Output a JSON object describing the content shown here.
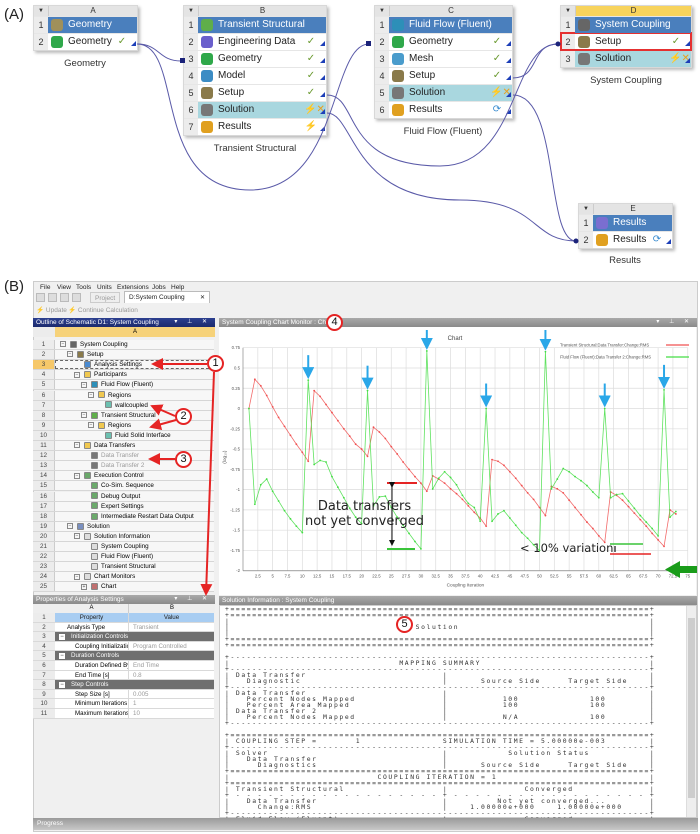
{
  "part_a": {
    "label": "(A)",
    "systems": [
      {
        "id": "geometry",
        "letter": "A",
        "caption": "Geometry",
        "rows": [
          {
            "n": "1",
            "label": "Geometry",
            "icon": "geometry-box-icon",
            "kind": "head"
          },
          {
            "n": "2",
            "label": "Geometry",
            "icon": "designmodeler-icon",
            "status": "check"
          }
        ]
      },
      {
        "id": "transient-structural",
        "letter": "B",
        "caption": "Transient Structural",
        "rows": [
          {
            "n": "1",
            "label": "Transient Structural",
            "icon": "transient-structural-icon",
            "kind": "head"
          },
          {
            "n": "2",
            "label": "Engineering Data",
            "icon": "engineering-data-icon",
            "status": "check"
          },
          {
            "n": "3",
            "label": "Geometry",
            "icon": "designmodeler-icon",
            "status": "check"
          },
          {
            "n": "4",
            "label": "Model",
            "icon": "model-icon",
            "status": "check"
          },
          {
            "n": "5",
            "label": "Setup",
            "icon": "setup-icon",
            "status": "check"
          },
          {
            "n": "6",
            "label": "Solution",
            "icon": "solution-icon",
            "status": "refresh-failed",
            "kind": "sol"
          },
          {
            "n": "7",
            "label": "Results",
            "icon": "results-icon",
            "status": "update-required"
          }
        ]
      },
      {
        "id": "fluid-flow",
        "letter": "C",
        "caption": "Fluid Flow (Fluent)",
        "rows": [
          {
            "n": "1",
            "label": "Fluid Flow (Fluent)",
            "icon": "fluent-icon",
            "kind": "head"
          },
          {
            "n": "2",
            "label": "Geometry",
            "icon": "designmodeler-icon",
            "status": "check"
          },
          {
            "n": "3",
            "label": "Mesh",
            "icon": "mesh-icon",
            "status": "check"
          },
          {
            "n": "4",
            "label": "Setup",
            "icon": "setup-icon",
            "status": "check"
          },
          {
            "n": "5",
            "label": "Solution",
            "icon": "solution-icon",
            "status": "refresh-failed",
            "kind": "sol"
          },
          {
            "n": "6",
            "label": "Results",
            "icon": "results-icon",
            "status": "refresh"
          }
        ]
      },
      {
        "id": "system-coupling",
        "letter": "D",
        "caption": "System Coupling",
        "rows": [
          {
            "n": "1",
            "label": "System Coupling",
            "icon": "system-coupling-icon",
            "kind": "head"
          },
          {
            "n": "2",
            "label": "Setup",
            "icon": "setup-icon",
            "status": "check",
            "kind": "highlight"
          },
          {
            "n": "3",
            "label": "Solution",
            "icon": "solution-icon",
            "status": "refresh-failed",
            "kind": "sol"
          }
        ]
      },
      {
        "id": "results",
        "letter": "E",
        "caption": "Results",
        "rows": [
          {
            "n": "1",
            "label": "Results",
            "icon": "results-eye-icon",
            "kind": "head"
          },
          {
            "n": "2",
            "label": "Results",
            "icon": "results-icon",
            "status": "refresh"
          }
        ]
      }
    ]
  },
  "part_b": {
    "label": "(B)",
    "menu": [
      "File",
      "View",
      "Tools",
      "Units",
      "Extensions",
      "Jobs",
      "Help"
    ],
    "tabs": {
      "project": "Project",
      "active": "D:System Coupling",
      "close": "✕"
    },
    "toolbar": {
      "update": "Update",
      "continue": "Continue Calculation"
    },
    "outline": {
      "title": "Outline of Schematic D1: System Coupling",
      "column": "A",
      "rows": [
        {
          "n": "1",
          "label": "System Coupling",
          "level": 0,
          "exp": "−",
          "icon": "system-coupling-icon"
        },
        {
          "n": "2",
          "label": "Setup",
          "level": 1,
          "exp": "−",
          "icon": "setup-icon"
        },
        {
          "n": "3",
          "label": "Analysis Settings",
          "level": 2,
          "icon": "analysis-settings-icon",
          "selected": true
        },
        {
          "n": "4",
          "label": "Participants",
          "level": 2,
          "exp": "−",
          "icon": "folder-icon"
        },
        {
          "n": "5",
          "label": "Fluid Flow (Fluent)",
          "level": 3,
          "exp": "−",
          "icon": "fluent-icon"
        },
        {
          "n": "6",
          "label": "Regions",
          "level": 4,
          "exp": "−",
          "icon": "folder-icon"
        },
        {
          "n": "7",
          "label": "wallcoupled",
          "level": 5,
          "icon": "region-icon"
        },
        {
          "n": "8",
          "label": "Transient Structural",
          "level": 3,
          "exp": "−",
          "icon": "transient-structural-icon"
        },
        {
          "n": "9",
          "label": "Regions",
          "level": 4,
          "exp": "−",
          "icon": "folder-icon"
        },
        {
          "n": "10",
          "label": "Fluid Solid Interface",
          "level": 5,
          "icon": "region-icon"
        },
        {
          "n": "11",
          "label": "Data Transfers",
          "level": 2,
          "exp": "−",
          "icon": "folder-icon"
        },
        {
          "n": "12",
          "label": "Data Transfer",
          "level": 3,
          "icon": "data-transfer-icon",
          "grey": true
        },
        {
          "n": "13",
          "label": "Data Transfer 2",
          "level": 3,
          "icon": "data-transfer-icon",
          "grey": true
        },
        {
          "n": "14",
          "label": "Execution Control",
          "level": 2,
          "exp": "−",
          "icon": "settings-sheet-icon"
        },
        {
          "n": "15",
          "label": "Co-Sim. Sequence",
          "level": 3,
          "icon": "settings-sheet-icon"
        },
        {
          "n": "16",
          "label": "Debug Output",
          "level": 3,
          "icon": "settings-sheet-icon"
        },
        {
          "n": "17",
          "label": "Expert Settings",
          "level": 3,
          "icon": "settings-sheet-icon"
        },
        {
          "n": "18",
          "label": "Intermediate Restart Data Output",
          "level": 3,
          "icon": "settings-sheet-icon"
        },
        {
          "n": "19",
          "label": "Solution",
          "level": 1,
          "exp": "−",
          "icon": "solution-icon"
        },
        {
          "n": "20",
          "label": "Solution Information",
          "level": 2,
          "exp": "−",
          "icon": "document-icon"
        },
        {
          "n": "21",
          "label": "System Coupling",
          "level": 3,
          "icon": "document-icon"
        },
        {
          "n": "22",
          "label": "Fluid Flow (Fluent)",
          "level": 3,
          "icon": "document-icon"
        },
        {
          "n": "23",
          "label": "Transient Structural",
          "level": 3,
          "icon": "document-icon"
        },
        {
          "n": "24",
          "label": "Chart Monitors",
          "level": 2,
          "exp": "−",
          "icon": "document-icon"
        },
        {
          "n": "25",
          "label": "Chart",
          "level": 3,
          "exp": "+",
          "icon": "chart-icon"
        }
      ]
    },
    "properties": {
      "title": "Properties of Analysis Settings",
      "columns": [
        "A",
        "B"
      ],
      "rows": [
        {
          "n": "1",
          "a": "Property",
          "b": "Value",
          "kind": "hdr"
        },
        {
          "n": "2",
          "a": "Analysis Type",
          "b": "Transient",
          "kind": "first"
        },
        {
          "n": "3",
          "a": "Initialization Controls",
          "b": "",
          "kind": "group"
        },
        {
          "n": "4",
          "a": "Coupling Initialization",
          "b": "Program Controlled",
          "kind": "sub"
        },
        {
          "n": "5",
          "a": "Duration Controls",
          "b": "",
          "kind": "group"
        },
        {
          "n": "6",
          "a": "Duration Defined By",
          "b": "End Time",
          "kind": "sub"
        },
        {
          "n": "7",
          "a": "End Time [s]",
          "b": "0.8",
          "kind": "sub"
        },
        {
          "n": "8",
          "a": "Step Controls",
          "b": "",
          "kind": "group"
        },
        {
          "n": "9",
          "a": "Step Size [s]",
          "b": "0.005",
          "kind": "sub"
        },
        {
          "n": "10",
          "a": "Minimum Iterations",
          "b": "1",
          "kind": "sub"
        },
        {
          "n": "11",
          "a": "Maximum Iterations",
          "b": "10",
          "kind": "sub"
        }
      ]
    },
    "chart_panel_title": "System Coupling Chart Monitor : Chart",
    "solution_panel_title": "Solution Information : System Coupling",
    "solution_lines": [
      "+=============================================================================+",
      "+=============================================================================+",
      "|                                                                             |",
      "|                                  Solution                                   |",
      "|                                                                             |",
      "+=============================================================================+",
      "+=============================================================================+",
      "",
      "+-----------------------------------------------------------------------------+",
      "|                               MAPPING SUMMARY                               |",
      "+-----------------------------------------------------------------------------+",
      "| Data Transfer                         |                                     |",
      "|   Diagnostic                          |      Source Side     Target Side    |",
      "+-----------------------------------------------------------------------------+",
      "| Data Transfer                         |                                     |",
      "|   Percent Nodes Mapped                |          100             100        |",
      "|   Percent Area Mapped                 |          100             100        |",
      "| Data Transfer 2                       |                                     |",
      "|   Percent Nodes Mapped                |          N/A             100        |",
      "+-----------------------------------------------------------------------------+",
      "",
      "+=============================================================================+",
      "| COUPLING STEP =       1               SIMULATION TIME = 5.00000e-003        |",
      "+-----------------------------------------------------------------------------+",
      "| Solver                                |           Solution Status           |",
      "|   Data Transfer                       |                                     |",
      "|     Diagnostics                       |      Source Side     Target Side    |",
      "+=============================================================================+",
      "|                           COUPLING ITERATION = 1                            |",
      "+=============================================================================+",
      "| Transient Structural                  |              Converged              |",
      "+ - - - - - - - - - - - - - - - - - - - + - - - - - - - - - - - - - - - - - - +",
      "|   Data Transfer                       |         Not yet converged...        |",
      "|     Change:RMS                        |    1.00000e+000    1.00000e+000     |",
      "+-----------------------------------------------------------------------------+",
      "| Fluid Flow (Fluent)                   |              Converged              |"
    ],
    "progress_label": "Progress",
    "callouts": [
      "1",
      "2",
      "3",
      "4",
      "5"
    ],
    "annotation_not_converged": [
      "Data transfers",
      "not yet converged"
    ],
    "annotation_variation": "< 10% variation"
  },
  "colors": {
    "red_series": "#f05050",
    "green_series": "#44dd44",
    "accent_blue": "#4a7fbd",
    "callout_red": "#e52424",
    "arrow_blue": "#2aa7e8",
    "arrow_green": "#1a9c1a"
  },
  "chart_data": {
    "type": "line",
    "title": "Chart",
    "xlabel": "Coupling Iteration",
    "ylabel": "(log₁₀)",
    "xlim": [
      0,
      75
    ],
    "ylim": [
      -2,
      0.75
    ],
    "grid": true,
    "legend_position": "top-right",
    "xticks": [
      "2.5",
      "5",
      "7.5",
      "10",
      "12.5",
      "15",
      "17.5",
      "20",
      "22.5",
      "25",
      "27.5",
      "30",
      "32.5",
      "35",
      "37.5",
      "40",
      "42.5",
      "45",
      "47.5",
      "50",
      "52.5",
      "55",
      "57.5",
      "60",
      "62.5",
      "65",
      "67.5",
      "70",
      "72.5",
      "75"
    ],
    "yticks": [
      "0.75",
      "0.5",
      "0.25",
      "0",
      "-0.25",
      "-0.5",
      "-0.75",
      "-1",
      "-1.25",
      "-1.5",
      "-1.75",
      "-2"
    ],
    "x": [
      1,
      2,
      3,
      4,
      5,
      6,
      7,
      8,
      9,
      10,
      11,
      12,
      13,
      14,
      15,
      16,
      17,
      18,
      19,
      20,
      21,
      22,
      23,
      24,
      25,
      26,
      27,
      28,
      29,
      30,
      31,
      32,
      33,
      34,
      35,
      36,
      37,
      38,
      39,
      40,
      41,
      42,
      43,
      44,
      45,
      46,
      47,
      48,
      49,
      50,
      51,
      52,
      53,
      54,
      55,
      56,
      57,
      58,
      59,
      60,
      61,
      62,
      63,
      64,
      65,
      66,
      67,
      68,
      69,
      70,
      71,
      72,
      73
    ],
    "series": [
      {
        "name": "Transient Structural:Data Transfer:Change:RMS",
        "color": "#f05050",
        "values": [
          0,
          0.36,
          0.28,
          0.16,
          0.02,
          -0.11,
          -0.22,
          -0.33,
          -0.44,
          -0.54,
          -0.65,
          0.22,
          0.15,
          0.05,
          -0.05,
          -0.15,
          -0.25,
          -0.34,
          -0.44,
          -0.5,
          -0.59,
          -0.23,
          -0.29,
          -0.37,
          -0.47,
          -0.56,
          -0.66,
          -0.75,
          -0.84,
          -0.92,
          -1.02,
          -0.83,
          -0.87,
          -0.92,
          -0.99,
          -1.05,
          -1.12,
          -1.2,
          -1.28,
          -1.35,
          -1.45,
          -0.63,
          -0.65,
          -0.7,
          -0.78,
          -0.86,
          -0.95,
          -1.04,
          -1.12,
          -1.22,
          -1.32,
          -0.96,
          -0.99,
          -1.04,
          -1.13,
          -1.22,
          -1.31,
          -1.4,
          -1.48,
          -1.57,
          -1.65,
          -1.03,
          -1.07,
          -1.13,
          -1.21,
          -1.29,
          -1.37,
          -1.45,
          -1.54,
          -1.62,
          -1.7,
          -1.25,
          -1.3
        ]
      },
      {
        "name": "Fluid Flow (Fluent):Data Transfer 2:Change:RMS",
        "color": "#44dd44",
        "values": [
          0,
          -1.18,
          -0.94,
          -0.87,
          -1.02,
          -1.14,
          -1.26,
          -1.36,
          -1.45,
          -1.53,
          0.35,
          -0.69,
          -0.64,
          -0.66,
          -0.84,
          -0.97,
          -1.1,
          -1.23,
          -1.34,
          -1.42,
          0.22,
          -1.2,
          -1.09,
          -1.08,
          -1.22,
          -1.34,
          -1.44,
          -1.54,
          -1.64,
          -1.73,
          0.71,
          -0.99,
          -0.86,
          -0.78,
          -0.85,
          -0.94,
          -1.07,
          -1.17,
          -1.22,
          -1.39,
          0.0,
          -1.39,
          -1.3,
          -1.26,
          -1.35,
          -1.44,
          -1.53,
          -1.6,
          -1.68,
          -1.75,
          0.7,
          -0.99,
          -0.87,
          -0.74,
          -0.78,
          -0.84,
          -0.89,
          -0.95,
          -1.03,
          -1.1,
          0.0,
          -1.1,
          -1.06,
          -1.05,
          -1.14,
          -1.23,
          -1.32,
          -1.4,
          -1.48,
          -1.57,
          0.23,
          -1.34,
          -1.27
        ]
      }
    ],
    "highlighted_spikes_x": [
      11,
      21,
      31,
      41,
      51,
      61,
      71
    ]
  }
}
